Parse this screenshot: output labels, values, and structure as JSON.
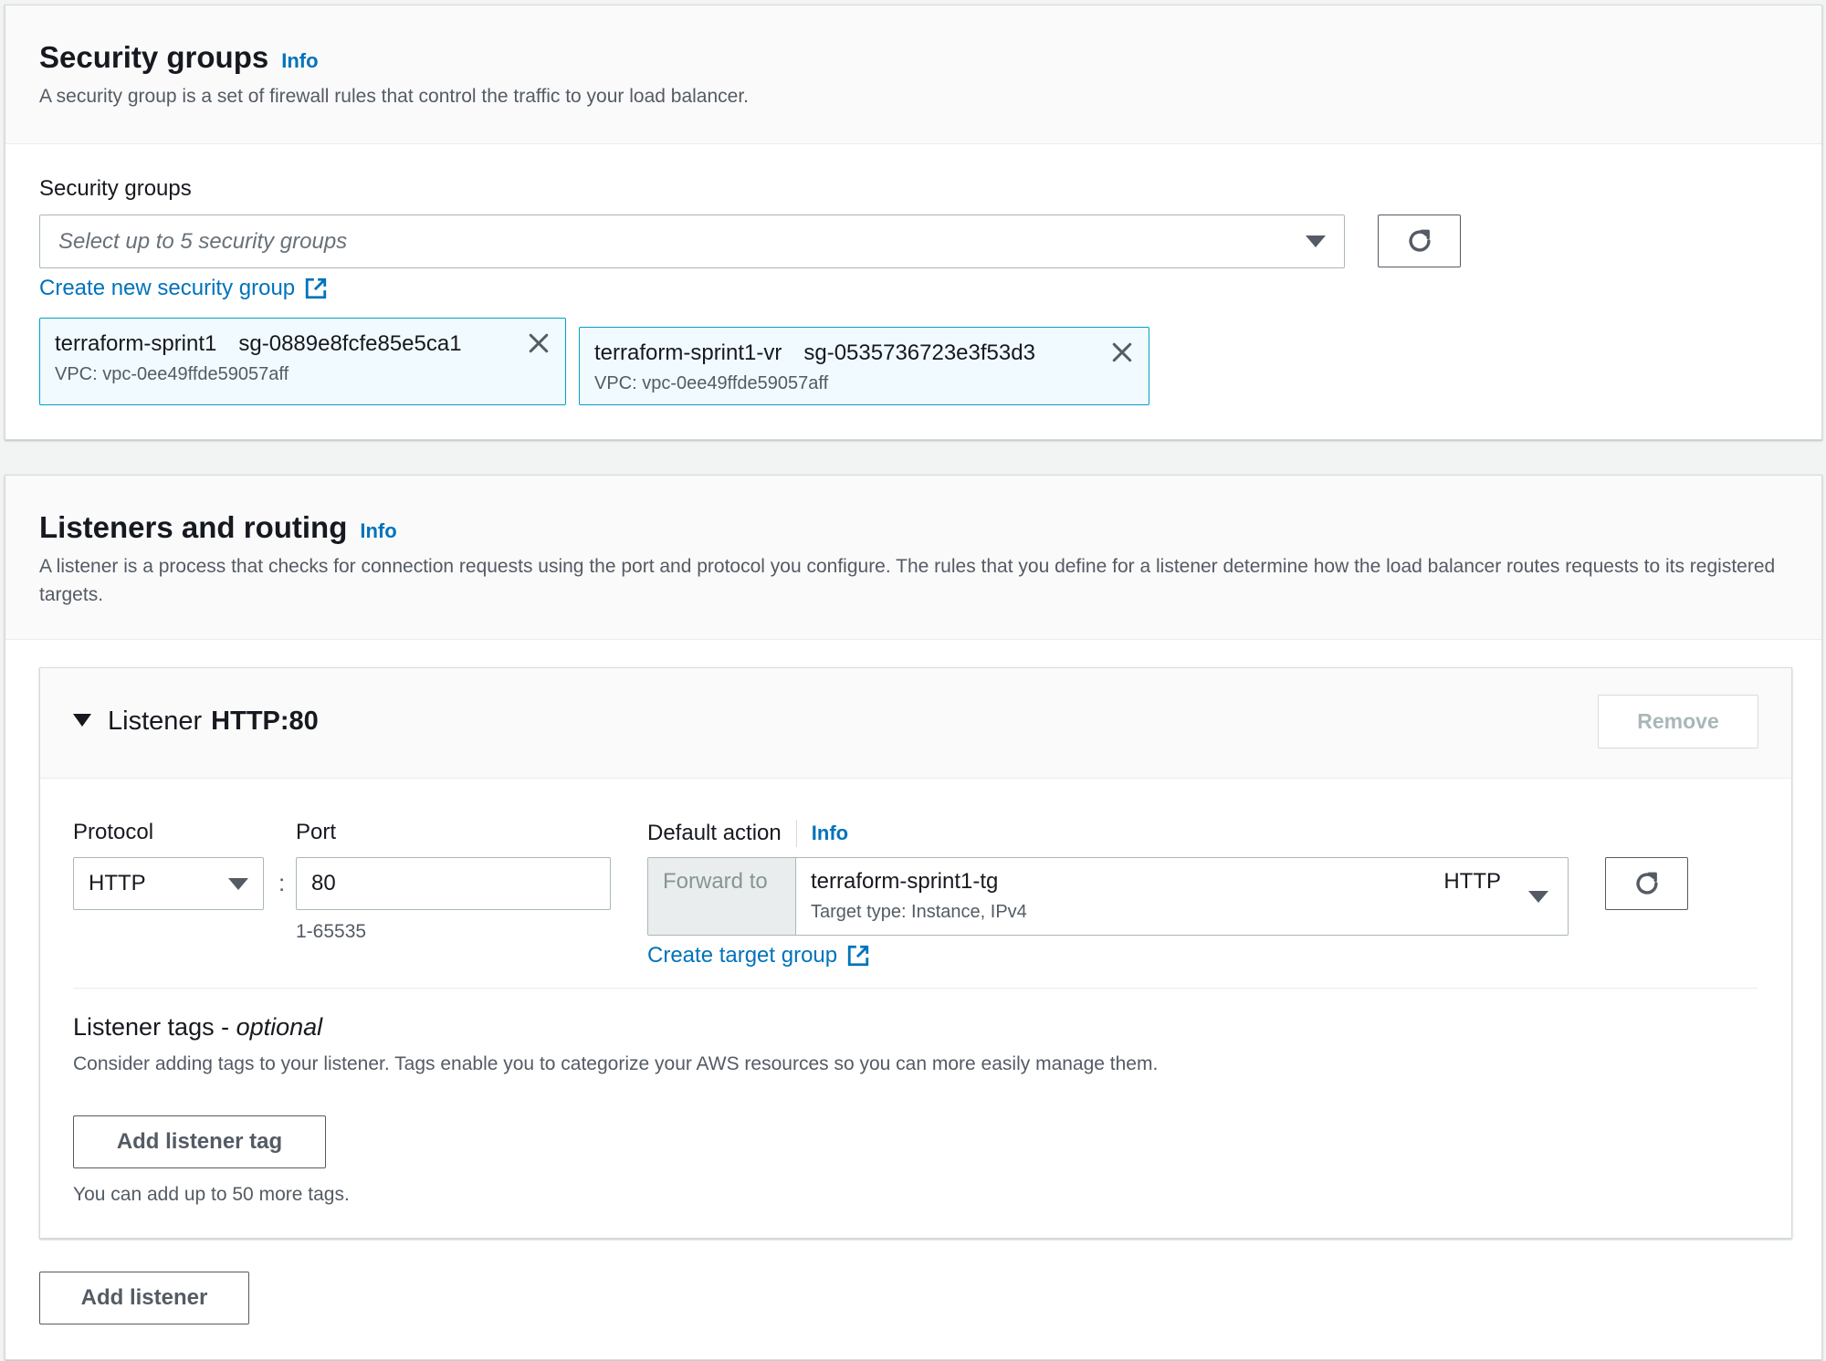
{
  "security_groups": {
    "title": "Security groups",
    "info": "Info",
    "description": "A security group is a set of firewall rules that control the traffic to your load balancer.",
    "field_label": "Security groups",
    "select_placeholder": "Select up to 5 security groups",
    "create_link": "Create new security group",
    "tokens": [
      {
        "name": "terraform-sprint1",
        "id": "sg-0889e8fcfe85e5ca1",
        "vpc": "VPC: vpc-0ee49ffde59057aff"
      },
      {
        "name": "terraform-sprint1-vr",
        "id": "sg-0535736723e3f53d3",
        "vpc": "VPC: vpc-0ee49ffde59057aff"
      }
    ]
  },
  "listeners": {
    "title": "Listeners and routing",
    "info": "Info",
    "description": "A listener is a process that checks for connection requests using the port and protocol you configure. The rules that you define for a listener determine how the load balancer routes requests to its registered targets.",
    "listener": {
      "label": "Listener",
      "name": "HTTP:80",
      "remove": "Remove",
      "protocol_label": "Protocol",
      "protocol_value": "HTTP",
      "colon": ":",
      "port_label": "Port",
      "port_value": "80",
      "port_hint": "1-65535",
      "default_action_label": "Default action",
      "default_action_info": "Info",
      "forward_to": "Forward to",
      "target_group_name": "terraform-sprint1-tg",
      "target_group_type": "Target type: Instance, IPv4",
      "target_group_protocol": "HTTP",
      "create_target_group": "Create target group",
      "tags_title": "Listener tags - ",
      "tags_optional": "optional",
      "tags_description": "Consider adding tags to your listener. Tags enable you to categorize your AWS resources so you can more easily manage them.",
      "add_tag": "Add listener tag",
      "tags_hint": "You can add up to 50 more tags."
    },
    "add_listener": "Add listener"
  },
  "colors": {
    "link": "#0073bb",
    "token_border": "#00a1c9",
    "token_bg": "#f1faff"
  },
  "icons": [
    "external-link-icon",
    "refresh-icon",
    "close-icon",
    "caret-down-icon"
  ]
}
